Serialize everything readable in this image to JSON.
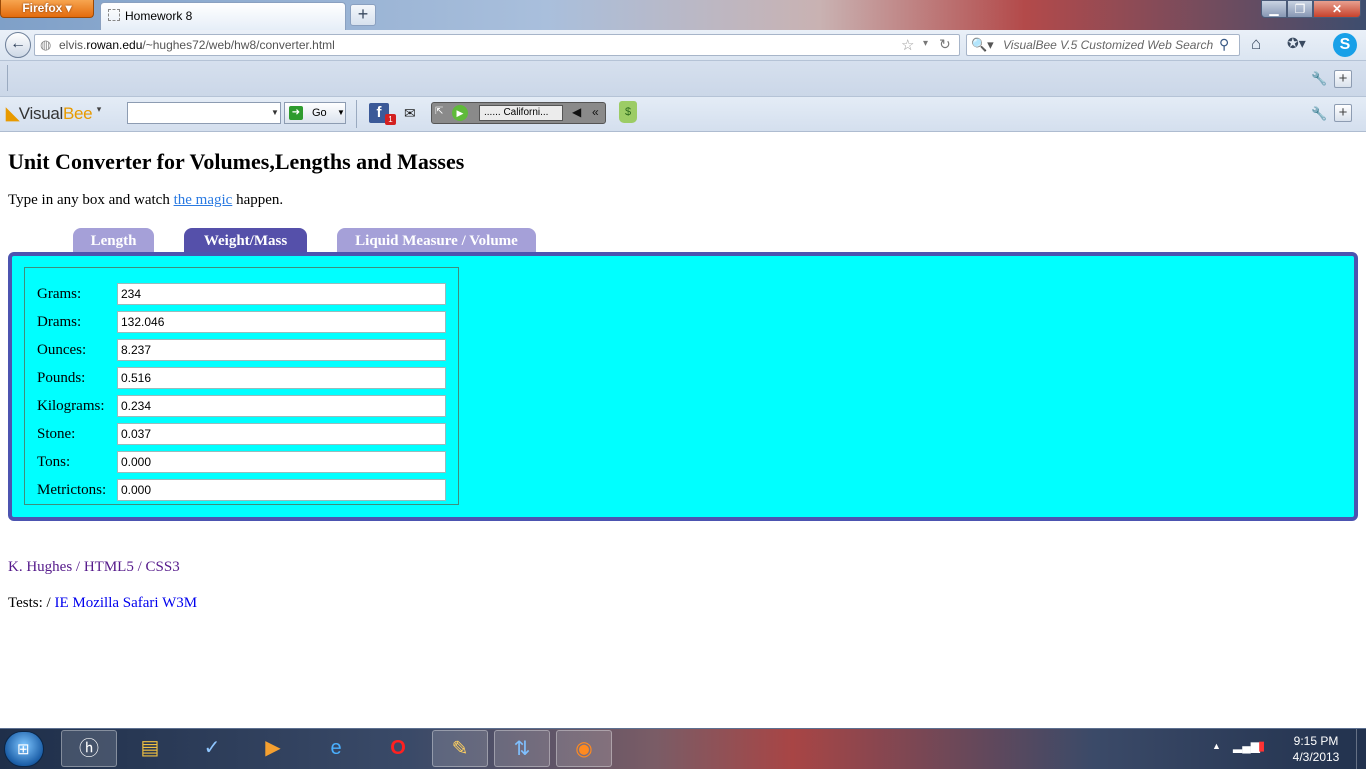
{
  "browser": {
    "app_button": "Firefox",
    "tab_title": "Homework 8",
    "url_host_prefix": "elvis.",
    "url_host_domain": "rowan.edu",
    "url_path": "/~hughes72/web/hw8/converter.html",
    "search_placeholder": "VisualBee V.5 Customized Web Search"
  },
  "visualbee": {
    "logo_part1": "Visual",
    "logo_part2": "Bee",
    "go_label": "Go",
    "station": "...... Californi...",
    "fb_badge": "1"
  },
  "page": {
    "title": "Unit Converter for Volumes,Lengths and Masses",
    "intro_before": "Type in any box and watch ",
    "intro_link": "the magic",
    "intro_after": " happen.",
    "tabs": [
      "Length",
      "Weight/Mass",
      "Liquid Measure / Volume"
    ],
    "active_tab": "Weight/Mass",
    "fields": [
      {
        "label": "Grams:",
        "value": "234"
      },
      {
        "label": "Drams:",
        "value": "132.046"
      },
      {
        "label": "Ounces:",
        "value": "8.237"
      },
      {
        "label": "Pounds:",
        "value": "0.516"
      },
      {
        "label": "Kilograms:",
        "value": "0.234"
      },
      {
        "label": "Stone:",
        "value": "0.037"
      },
      {
        "label": "Tons:",
        "value": "0.000"
      },
      {
        "label": "Metrictons:",
        "value": "0.000"
      }
    ],
    "credit_author": "K. Hughes",
    "credit_sep1": " / ",
    "credit_html": "HTML5",
    "credit_sep2": " / ",
    "credit_css": "CSS3",
    "tests_prefix": "Tests: / ",
    "tests_links": [
      "IE",
      "Mozilla",
      "Safari",
      "W3M"
    ]
  },
  "taskbar": {
    "time": "9:15 PM",
    "date": "4/3/2013"
  },
  "colors": {
    "panel_bg": "#00ffff",
    "panel_border": "#4c54b0",
    "tab_active": "#5550aa",
    "tab_inactive": "#a5a0d8",
    "link_visited": "#551a8b",
    "link": "#0000ee"
  }
}
